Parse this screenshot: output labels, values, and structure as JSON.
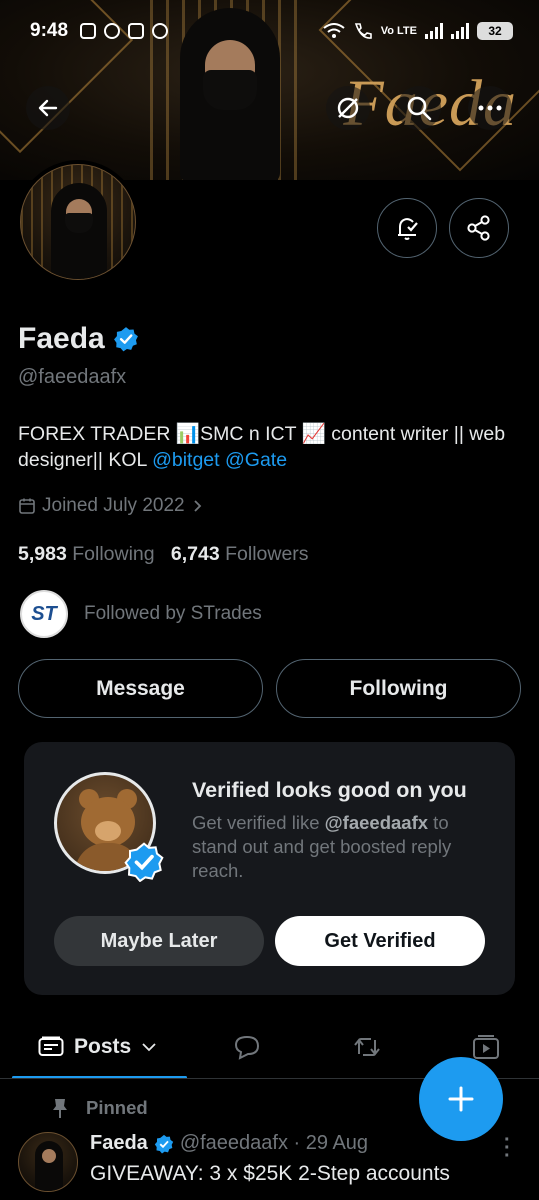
{
  "status_bar": {
    "time": "9:48",
    "network_label": "Vo LTE",
    "battery": "32"
  },
  "banner": {
    "text": "Faeda"
  },
  "profile": {
    "name": "Faeda",
    "handle": "@faeedaafx",
    "bio_text": "FOREX TRADER 📊SMC n ICT 📈 content writer || web designer|| KOL ",
    "bio_mentions": [
      "@bitget",
      "@Gate"
    ],
    "joined": "Joined July 2022",
    "following_count": "5,983",
    "following_label": "Following",
    "followers_count": "6,743",
    "followers_label": "Followers",
    "followed_by": "Followed by STrades",
    "st_avatar_text": "ST"
  },
  "actions": {
    "message": "Message",
    "following": "Following"
  },
  "verified_card": {
    "title": "Verified looks good on you",
    "desc_prefix": "Get verified like ",
    "desc_handle": "@faeedaafx",
    "desc_suffix": " to stand out and get boosted reply reach.",
    "maybe_later": "Maybe Later",
    "get_verified": "Get Verified"
  },
  "tabs": {
    "posts": "Posts"
  },
  "pinned_post": {
    "pinned_label": "Pinned",
    "author": "Faeda",
    "handle_date": "@faeedaafx · 29 Aug",
    "text": "GIVEAWAY: 3 x $25K 2-Step accounts"
  },
  "colors": {
    "accent": "#1d9bf0",
    "background": "#000000",
    "muted": "#71767b",
    "card": "#16181c"
  }
}
